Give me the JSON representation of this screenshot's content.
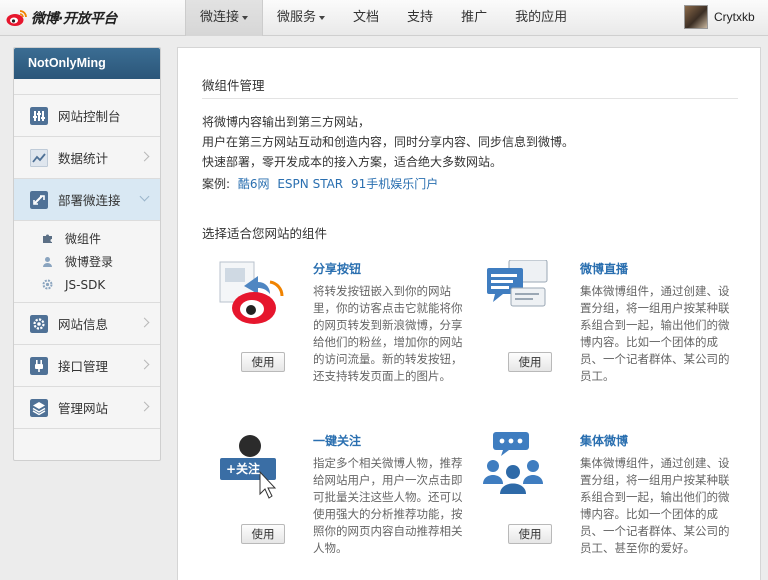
{
  "topbar": {
    "brand": "微博·开放平台",
    "nav": [
      {
        "label": "微连接",
        "caret": true,
        "active": true
      },
      {
        "label": "微服务",
        "caret": true,
        "active": false
      },
      {
        "label": "文档",
        "caret": false,
        "active": false
      },
      {
        "label": "支持",
        "caret": false,
        "active": false
      },
      {
        "label": "推广",
        "caret": false,
        "active": false
      },
      {
        "label": "我的应用",
        "caret": false,
        "active": false
      }
    ],
    "username": "Crytxkb"
  },
  "sidebar": {
    "title": "NotOnlyMing",
    "items": [
      {
        "label": "网站控制台",
        "icon": "sliders-icon"
      },
      {
        "label": "数据统计",
        "icon": "chart-icon"
      },
      {
        "label": "部署微连接",
        "icon": "link-icon",
        "active": true
      },
      {
        "label": "网站信息",
        "icon": "gear-icon"
      },
      {
        "label": "接口管理",
        "icon": "plug-icon"
      },
      {
        "label": "管理网站",
        "icon": "layers-icon"
      }
    ],
    "subitems": [
      {
        "label": "微组件",
        "icon": "puzzle-icon"
      },
      {
        "label": "微博登录",
        "icon": "person-icon"
      },
      {
        "label": "JS-SDK",
        "icon": "cog-icon"
      }
    ]
  },
  "main": {
    "section_title": "微组件管理",
    "intro": [
      "将微博内容输出到第三方网站，",
      "用户在第三方网站互动和创造内容，同时分享内容、同步信息到微博。",
      "快速部署，零开发成本的接入方案，适合绝大多数网站。"
    ],
    "cases_label": "案例:",
    "cases": [
      "酷6网",
      "ESPN STAR",
      "91手机娱乐门户"
    ],
    "choose_title": "选择适合您网站的组件",
    "use_label": "使用",
    "widgets": [
      {
        "title": "分享按钮",
        "desc": "将转发按钮嵌入到你的网站里，你的访客点击它就能将你的网页转发到新浪微博，分享给他们的粉丝，增加你的网站的访问流量。新的转发按钮，还支持转发页面上的图片。"
      },
      {
        "title": "微博直播",
        "desc": "集体微博组件，通过创建、设置分组，将一组用户按某种联系组合到一起，输出他们的微博内容。比如一个团体的成员、一个记者群体、某公司的员工。"
      },
      {
        "title": "一键关注",
        "desc": "指定多个相关微博人物，推荐给网站用户，用户一次点击即可批量关注这些人物。还可以使用强大的分析推荐功能，按照你的网页内容自动推荐相关人物。"
      },
      {
        "title": "集体微博",
        "desc": "集体微博组件，通过创建、设置分组，将一组用户按某种联系组合到一起，输出他们的微博内容。比如一个团体的成员、一个记者群体、某公司的员工、甚至你的爱好。"
      }
    ],
    "follow_badge": "+关注"
  }
}
